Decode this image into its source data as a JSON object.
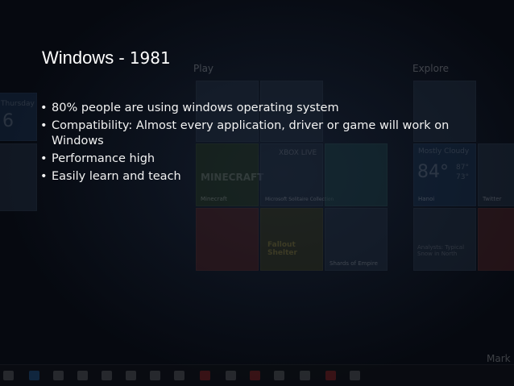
{
  "slide": {
    "title": "Windows",
    "title_separator": " - ",
    "year": "1981",
    "bullets": [
      "80% people are using windows operating system",
      "Compatibility: Almost every application, driver or game will work on Windows",
      "Performance high",
      "Easily learn and teach"
    ]
  },
  "background": {
    "section_labels": [
      "Play",
      "Explore"
    ],
    "day_name": "Thursday",
    "day_number": "6",
    "weather": {
      "condition": "Mostly Cloudy",
      "temp": "84°",
      "high": "87°",
      "low": "73°",
      "city": "Hanoi"
    },
    "tile_labels": [
      "Minecraft",
      "Microsoft Solitaire Collection",
      "Shards of Empire",
      "Twitter",
      "Fallout Shelter"
    ],
    "tile_brand_text": [
      "XBOX LIVE",
      "MINECRAFT",
      "Fallout Shelter"
    ],
    "news_text": "Analysts: Typical Snow in North",
    "corner_text": "Mark"
  },
  "colors": {
    "background": "#060910",
    "text": "#f2f2f2",
    "title": "#ffffff"
  }
}
